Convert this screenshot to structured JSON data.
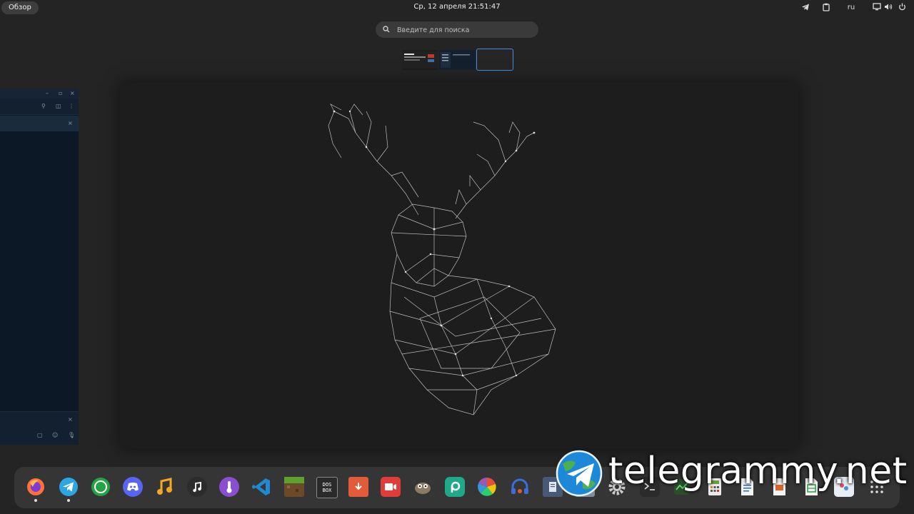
{
  "topbar": {
    "overview_label": "Обзор",
    "datetime": "Ср, 12 апреля  21:51:47",
    "language": "ru",
    "icons": [
      "telegram-tray-icon",
      "clipboard-icon",
      "screen-icon",
      "volume-icon",
      "power-icon"
    ]
  },
  "search": {
    "placeholder": "Введите для поиска",
    "value": ""
  },
  "workspaces": {
    "count": 3,
    "active_index": 2
  },
  "dock": {
    "apps": [
      {
        "name": "firefox",
        "running": true
      },
      {
        "name": "telegram",
        "running": true
      },
      {
        "name": "whatsapp",
        "running": false
      },
      {
        "name": "discord",
        "running": false
      },
      {
        "name": "music-player",
        "running": false
      },
      {
        "name": "music-note-app",
        "running": false
      },
      {
        "name": "thermometer-app",
        "running": false
      },
      {
        "name": "vscode",
        "running": false
      },
      {
        "name": "minecraft",
        "running": false
      },
      {
        "name": "dosbox",
        "running": false
      },
      {
        "name": "video-downloader",
        "running": false
      },
      {
        "name": "screen-recorder",
        "running": false
      },
      {
        "name": "gimp",
        "running": false
      },
      {
        "name": "picsart",
        "running": false
      },
      {
        "name": "color-picker",
        "running": false
      },
      {
        "name": "headphones-app",
        "running": false
      }
    ],
    "dosbox_label": "DOS BOX",
    "colors": {
      "accent": "#3e8fe0",
      "dock_bg": "#353535"
    }
  },
  "watermark": {
    "text": "telegrammy.net"
  }
}
